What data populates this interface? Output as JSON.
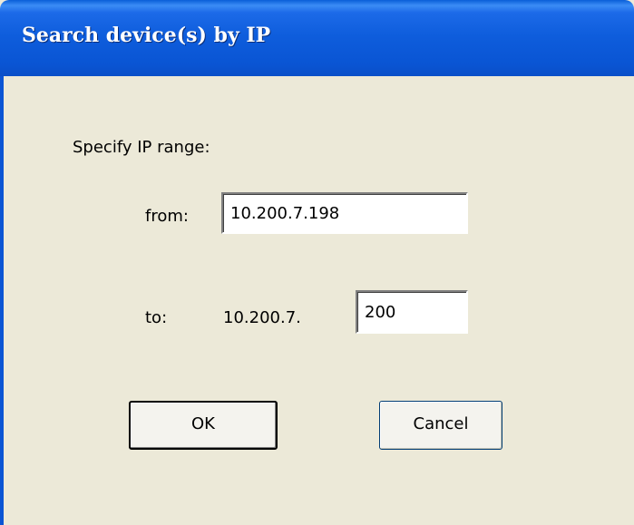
{
  "window": {
    "title": "Search device(s) by IP"
  },
  "form": {
    "heading": "Specify IP range:",
    "from_label": "from:",
    "from_value": "10.200.7.198",
    "to_label": "to:",
    "to_prefix": "10.200.7.",
    "to_value": "200"
  },
  "buttons": {
    "ok_label": "OK",
    "cancel_label": "Cancel"
  }
}
